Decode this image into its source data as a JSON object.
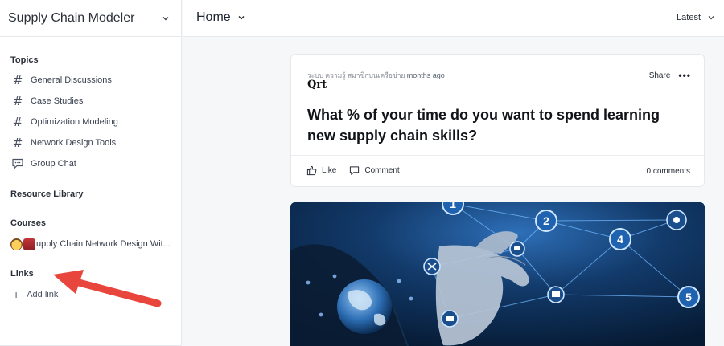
{
  "sidebar": {
    "app_title": "Supply Chain Modeler",
    "topics_label": "Topics",
    "topics": [
      {
        "label": "General Discussions",
        "icon": "hash-icon"
      },
      {
        "label": "Case Studies",
        "icon": "hash-icon"
      },
      {
        "label": "Optimization Modeling",
        "icon": "hash-icon"
      },
      {
        "label": "Network Design Tools",
        "icon": "hash-icon"
      },
      {
        "label": "Group Chat",
        "icon": "chat-bubble-icon"
      }
    ],
    "resource_library_label": "Resource Library",
    "courses_label": "Courses",
    "course_item": "upply Chain Network Design Wit...",
    "links_label": "Links",
    "add_link_label": "Add link"
  },
  "topbar": {
    "title": "Home",
    "sort_label": "Latest"
  },
  "post": {
    "meta_text": "ระบบ ความรู้ สมาชิกบนเครือข่าย",
    "time_ago": "months ago",
    "author": "Qrt",
    "share_label": "Share",
    "more_label": "•••",
    "title": "What % of your time do you want to spend learning new supply chain skills?",
    "like_label": "Like",
    "comment_label": "Comment",
    "comments_count": "0 comments"
  },
  "image": {
    "network_node_labels": [
      "1",
      "2",
      "4",
      "5"
    ]
  },
  "colors": {
    "accent_arrow": "#e8453c",
    "image_bg": "#0b2a4e",
    "node_blue": "#2f7fd6"
  }
}
